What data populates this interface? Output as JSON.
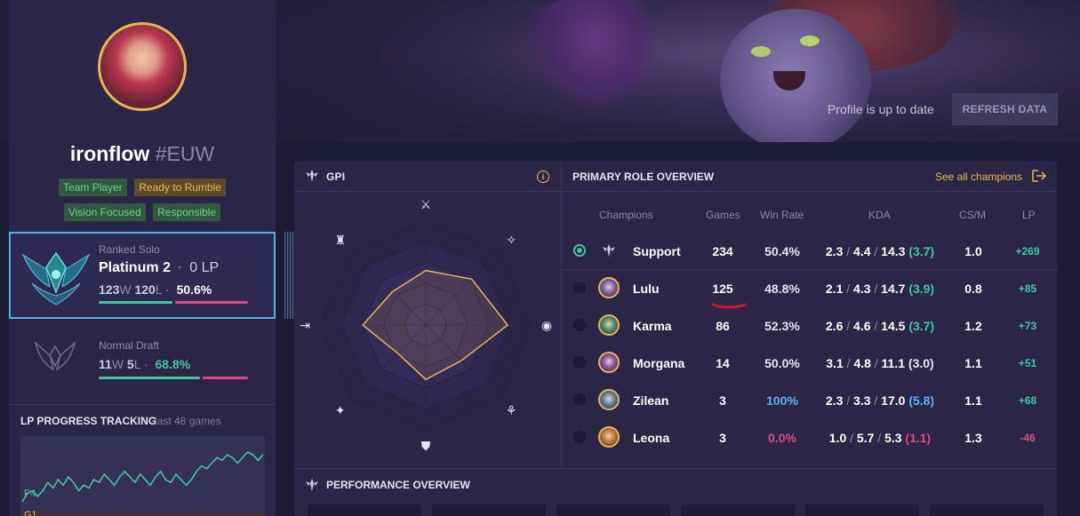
{
  "header": {
    "status_text": "Profile is up to date",
    "refresh_label": "REFRESH DATA"
  },
  "profile": {
    "name": "ironflow",
    "tag": "#EUW",
    "tags_row1": [
      "Team Player",
      "Ready to Rumble"
    ],
    "tags_row2": [
      "Vision Focused",
      "Responsible"
    ]
  },
  "ranked": {
    "label": "Ranked Solo",
    "tier": "Platinum 2",
    "lp": "0 LP",
    "wins": "123",
    "losses": "120",
    "w": "W",
    "l": "L",
    "winrate": "50.6%",
    "win_fraction": 0.506
  },
  "normal": {
    "label": "Normal Draft",
    "wins": "11",
    "losses": "5",
    "w": "W",
    "l": "L",
    "winrate": "68.8%",
    "win_fraction": 0.688
  },
  "lp_tracking": {
    "title": "LP PROGRESS TRACKING",
    "subtitle": "last 48 games",
    "tier_labels": [
      "P4",
      "G1"
    ],
    "points": [
      1,
      4,
      5,
      3,
      5,
      8,
      6,
      9,
      7,
      10,
      8,
      5,
      7,
      6,
      9,
      8,
      11,
      9,
      7,
      10,
      12,
      10,
      8,
      11,
      9,
      7,
      10,
      12,
      9,
      8,
      11,
      9,
      7,
      9,
      12,
      14,
      13,
      15,
      17,
      16,
      18,
      17,
      15,
      17,
      19,
      18,
      16,
      18
    ]
  },
  "gpi": {
    "title": "GPI",
    "info_label": "i",
    "axes": [
      "fighting",
      "farming",
      "vision",
      "aggression",
      "survivability",
      "versatility",
      "consistency",
      "objectives"
    ],
    "values": [
      0.52,
      0.62,
      0.78,
      0.48,
      0.52,
      0.38,
      0.6,
      0.45
    ]
  },
  "role_overview": {
    "title": "PRIMARY ROLE OVERVIEW",
    "see_all": "See all champions",
    "headers": [
      "Champions",
      "Games",
      "Win Rate",
      "KDA",
      "CS/M",
      "LP"
    ],
    "rows": [
      {
        "name": "Support",
        "games": "234",
        "winrate": "50.4%",
        "k": "2.3",
        "d": "4.4",
        "a": "14.3",
        "ratio": "(3.7)",
        "csm": "1.0",
        "lp": "+269",
        "wr_color": "#e6e4f2",
        "ratio_color": "#3fc7a0",
        "lp_color": "#3fc7a0",
        "icon": "support-role-icon",
        "champ_color": ""
      },
      {
        "name": "Lulu",
        "games": "125",
        "winrate": "48.8%",
        "k": "2.1",
        "d": "4.3",
        "a": "14.7",
        "ratio": "(3.9)",
        "csm": "0.8",
        "lp": "+85",
        "wr_color": "#e6e4f2",
        "ratio_color": "#3fc7a0",
        "lp_color": "#3fc7a0",
        "icon": "lulu-champion-icon",
        "champ_color": "#7a5fb0"
      },
      {
        "name": "Karma",
        "games": "86",
        "winrate": "52.3%",
        "k": "2.6",
        "d": "4.6",
        "a": "14.5",
        "ratio": "(3.7)",
        "csm": "1.2",
        "lp": "+73",
        "wr_color": "#e6e4f2",
        "ratio_color": "#3fc7a0",
        "lp_color": "#3fc7a0",
        "icon": "karma-champion-icon",
        "champ_color": "#4f8a6a"
      },
      {
        "name": "Morgana",
        "games": "14",
        "winrate": "50.0%",
        "k": "3.1",
        "d": "4.8",
        "a": "11.1",
        "ratio": "(3.0)",
        "csm": "1.1",
        "lp": "+51",
        "wr_color": "#e6e4f2",
        "ratio_color": "#e6e4f2",
        "lp_color": "#3fc7a0",
        "icon": "morgana-champion-icon",
        "champ_color": "#8d4fa8"
      },
      {
        "name": "Zilean",
        "games": "3",
        "winrate": "100%",
        "k": "2.3",
        "d": "3.3",
        "a": "17.0",
        "ratio": "(5.8)",
        "csm": "1.1",
        "lp": "+68",
        "wr_color": "#5fb0f0",
        "ratio_color": "#5fb0f0",
        "lp_color": "#3fc7a0",
        "icon": "zilean-champion-icon",
        "champ_color": "#5a7fa0"
      },
      {
        "name": "Leona",
        "games": "3",
        "winrate": "0.0%",
        "k": "1.0",
        "d": "5.7",
        "a": "5.3",
        "ratio": "(1.1)",
        "csm": "1.3",
        "lp": "-46",
        "wr_color": "#e0487f",
        "ratio_color": "#e0487f",
        "lp_color": "#e0487f",
        "icon": "leona-champion-icon",
        "champ_color": "#c07a3a"
      }
    ]
  },
  "performance": {
    "title": "PERFORMANCE OVERVIEW"
  },
  "colors": {
    "accent_green": "#3fc7a0",
    "accent_pink": "#e0487f",
    "accent_gold": "#e8b84a",
    "accent_blue": "#4cb3e0"
  }
}
